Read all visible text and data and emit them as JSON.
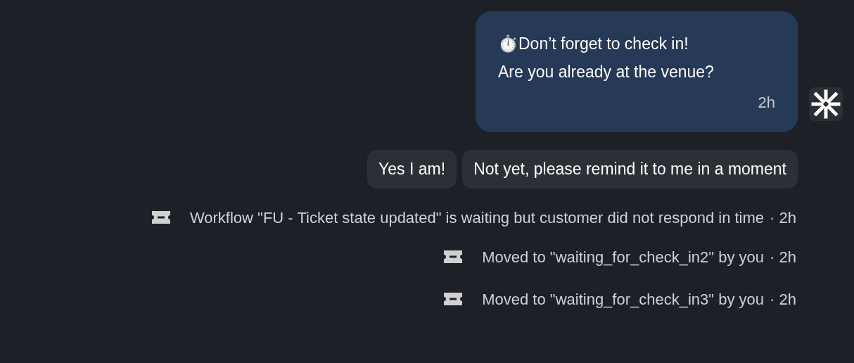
{
  "message": {
    "lines": [
      "⏱️Don’t forget to check in!",
      "Are you already at the venue?"
    ],
    "time": "2h"
  },
  "quick_replies": [
    "Yes I am!",
    "Not yet, please remind it to me in a moment"
  ],
  "events": [
    {
      "text": "Workflow \"FU - Ticket state updated\" is waiting but customer did not respond in time",
      "time": "· 2h"
    },
    {
      "text": "Moved to \"waiting_for_check_in2\" by you",
      "time": "· 2h"
    },
    {
      "text": "Moved to \"waiting_for_check_in3\" by you",
      "time": "· 2h"
    }
  ]
}
